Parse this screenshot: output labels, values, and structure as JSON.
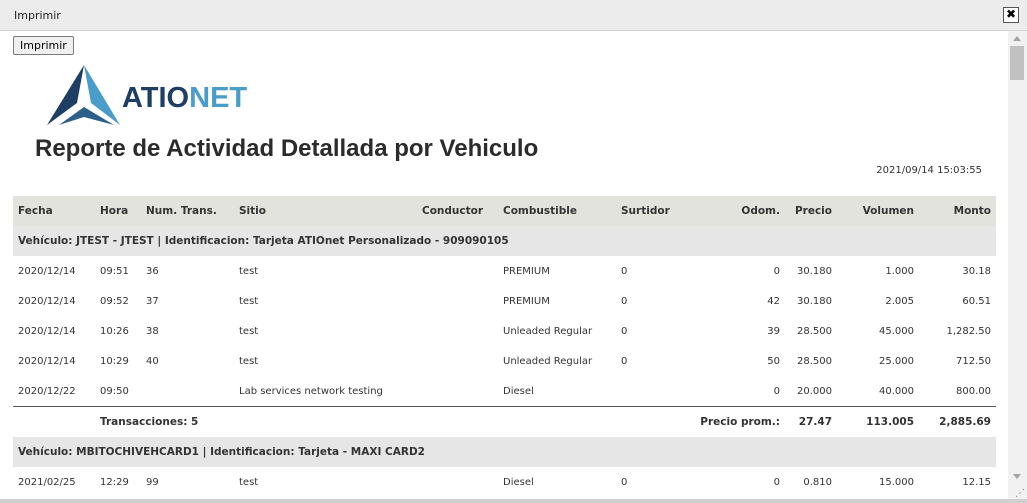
{
  "window": {
    "title": "Imprimir",
    "close_glyph": "✖"
  },
  "print_button": "Imprimir",
  "logo": {
    "text_a": "ATIO",
    "text_b": "NET",
    "colors": {
      "dark": "#1f3e63",
      "light": "#4a9cc9"
    }
  },
  "report": {
    "title": "Reporte de Actividad Detallada por Vehiculo",
    "generated": "2021/09/14 15:03:55",
    "columns": [
      "Fecha",
      "Hora",
      "Num. Trans.",
      "Sitio",
      "Conductor",
      "Combustible",
      "Surtidor",
      "Odom.",
      "Precio",
      "Volumen",
      "Monto"
    ],
    "groups": [
      {
        "label": "Vehículo: JTEST - JTEST | Identificacion: Tarjeta ATIOnet Personalizado - 909090105",
        "rows": [
          [
            "2020/12/14",
            "09:51",
            "36",
            "test",
            "",
            "PREMIUM",
            "0",
            "0",
            "30.180",
            "1.000",
            "30.18"
          ],
          [
            "2020/12/14",
            "09:52",
            "37",
            "test",
            "",
            "PREMIUM",
            "0",
            "42",
            "30.180",
            "2.005",
            "60.51"
          ],
          [
            "2020/12/14",
            "10:26",
            "38",
            "test",
            "",
            "Unleaded Regular",
            "0",
            "39",
            "28.500",
            "45.000",
            "1,282.50"
          ],
          [
            "2020/12/14",
            "10:29",
            "40",
            "test",
            "",
            "Unleaded Regular",
            "0",
            "50",
            "28.500",
            "25.000",
            "712.50"
          ],
          [
            "2020/12/22",
            "09:50",
            "",
            "Lab services network testing",
            "",
            "Diesel",
            "",
            "0",
            "20.000",
            "40.000",
            "800.00"
          ]
        ],
        "totals": {
          "transactions": "Transacciones: 5",
          "avg_label": "Precio prom.:",
          "avg_price": "27.47",
          "volume": "113.005",
          "amount": "2,885.69"
        }
      },
      {
        "label": "Vehículo: MBITOCHIVEHCARD1 | Identificacion: Tarjeta - MAXI CARD2",
        "rows": [
          [
            "2021/02/25",
            "12:29",
            "99",
            "test",
            "",
            "Diesel",
            "0",
            "0",
            "0.810",
            "15.000",
            "12.15"
          ]
        ]
      }
    ]
  }
}
